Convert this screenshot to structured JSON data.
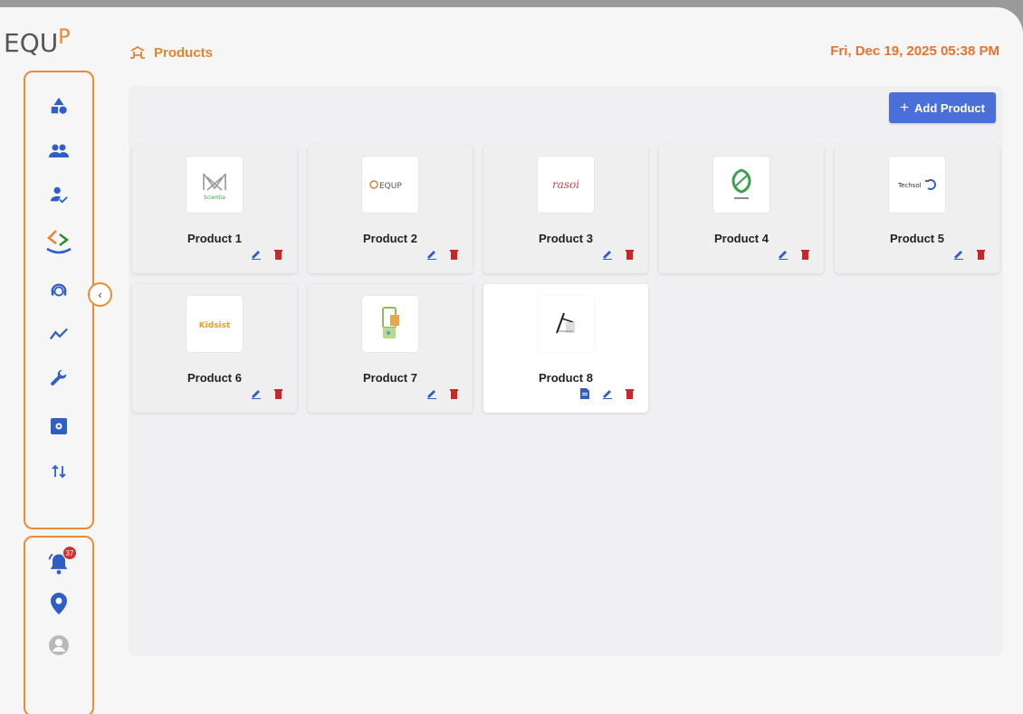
{
  "app": {
    "logo_text": "EQU",
    "logo_accent": "P",
    "page_title": "Products",
    "datetime": "Fri, Dec 19, 2025 05:38 PM"
  },
  "colors": {
    "accent": "#e8822d",
    "primary": "#4a6fd8",
    "nav_icon": "#2f5fc4",
    "delete": "#c62828",
    "badge": "#d32f2f"
  },
  "sidebar": {
    "items": [
      {
        "icon": "shapes-icon"
      },
      {
        "icon": "groups-icon"
      },
      {
        "icon": "person-check-icon"
      },
      {
        "icon": "brand-logo-icon"
      },
      {
        "icon": "support-agent-icon"
      },
      {
        "icon": "trending-icon"
      },
      {
        "icon": "wrench-icon"
      },
      {
        "icon": "settings-box-icon"
      },
      {
        "icon": "sort-arrows-icon"
      }
    ],
    "collapse_label": "‹",
    "bottom": {
      "notification_count": "37",
      "items": [
        {
          "icon": "bell-icon"
        },
        {
          "icon": "location-pin-icon"
        },
        {
          "icon": "account-icon"
        }
      ]
    }
  },
  "toolbar": {
    "add_label": "Add Product",
    "add_icon": "plus-icon"
  },
  "products": [
    {
      "name": "Product 1",
      "logo": "Scientia"
    },
    {
      "name": "Product 2",
      "logo": "EQUP"
    },
    {
      "name": "Product 3",
      "logo": "rasoi"
    },
    {
      "name": "Product 4",
      "logo": ""
    },
    {
      "name": "Product 5",
      "logo": "Techsol"
    },
    {
      "name": "Product 6",
      "logo": "Kidsist"
    },
    {
      "name": "Product 7",
      "logo": ""
    },
    {
      "name": "Product 8",
      "logo": ""
    }
  ]
}
